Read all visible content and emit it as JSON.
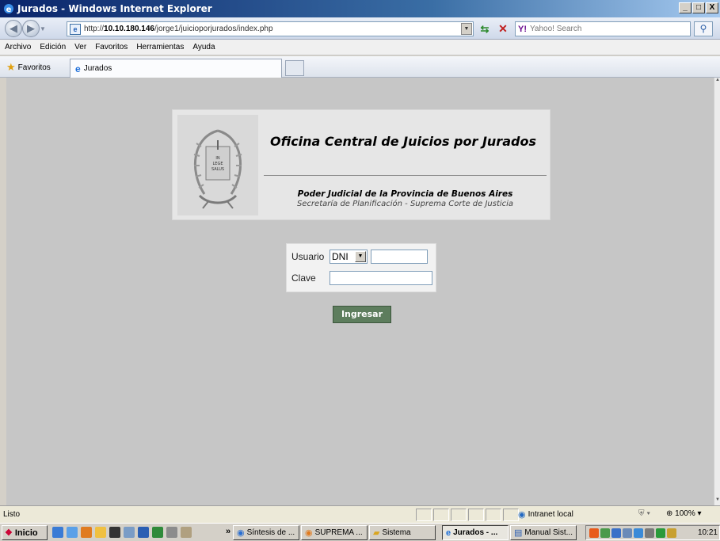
{
  "window": {
    "title": "Jurados - Windows Internet Explorer",
    "controls": [
      "_",
      "□",
      "X"
    ]
  },
  "address_bar": {
    "url_prefix": "http://",
    "url_host": "10.10.180.146",
    "url_path": "/jorge1/juicioporjurados/index.php",
    "search_placeholder": "Yahoo! Search"
  },
  "menu": {
    "items": [
      "Archivo",
      "Edición",
      "Ver",
      "Favoritos",
      "Herramientas",
      "Ayuda"
    ]
  },
  "favorites_bar": {
    "favorites_label": "Favoritos",
    "tab_label": "Jurados"
  },
  "page": {
    "header_title": "Oficina Central de Juicios por Jurados",
    "header_sub1": "Poder Judicial de la Provincia de Buenos Aires",
    "header_sub2": "Secretaría de Planificación - Suprema Corte de Justicia",
    "seal_text": [
      "IN",
      "LEGE",
      "SALUS"
    ],
    "login": {
      "usuario_label": "Usuario",
      "doc_type_selected": "DNI",
      "usuario_value": "",
      "clave_label": "Clave",
      "clave_value": "",
      "submit_label": "Ingresar"
    }
  },
  "status_bar": {
    "status_text": "Listo",
    "zone_text": "Intranet local",
    "zoom_text": "100%"
  },
  "taskbar": {
    "start_label": "Inicio",
    "buttons": [
      "Síntesis de ...",
      "SUPREMA ...",
      "Sistema",
      "Jurados - ...",
      "Manual Sist..."
    ],
    "clock": "10:21"
  },
  "colors": {
    "page_background": "#c6c6c6",
    "button_green": "#5d7d5d"
  }
}
